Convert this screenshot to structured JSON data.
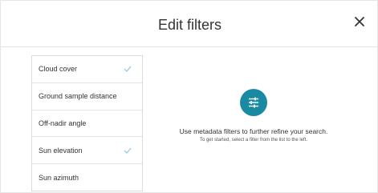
{
  "dialog": {
    "title": "Edit filters"
  },
  "filters": {
    "items": [
      {
        "label": "Cloud cover",
        "selected": true
      },
      {
        "label": "Ground sample distance",
        "selected": false
      },
      {
        "label": "Off-nadir angle",
        "selected": false
      },
      {
        "label": "Sun elevation",
        "selected": true
      },
      {
        "label": "Sun azimuth",
        "selected": false
      }
    ]
  },
  "empty_state": {
    "icon": "sliders-icon",
    "message": "Use metadata filters to further refine your search.",
    "hint": "To get started, select a filter from the list to the left."
  },
  "colors": {
    "accent": "#1a8aa2",
    "check": "#8ec5e0"
  }
}
